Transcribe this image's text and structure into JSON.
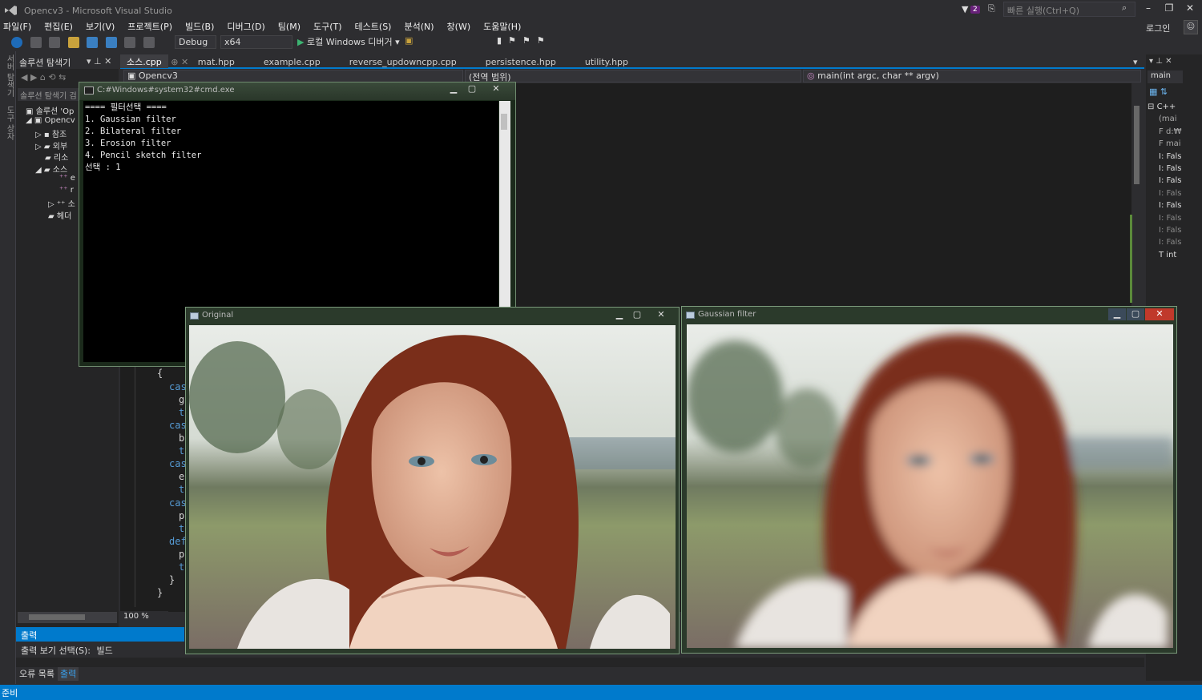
{
  "window": {
    "title": "Opencv3 - Microsoft Visual Studio",
    "notifications": "2",
    "quick_launch_placeholder": "빠른 실행(Ctrl+Q)",
    "login": "로그인"
  },
  "menu": [
    "파일(F)",
    "편집(E)",
    "보기(V)",
    "프로젝트(P)",
    "빌드(B)",
    "디버그(D)",
    "팀(M)",
    "도구(T)",
    "테스트(S)",
    "분석(N)",
    "창(W)",
    "도움말(H)"
  ],
  "toolbar": {
    "config": "Debug",
    "platform": "x64",
    "run_label": "로컬 Windows 디버거"
  },
  "left_strip": {
    "item1": "서버 탐색기",
    "item2": "도구 상자"
  },
  "solution_explorer": {
    "title": "솔루션 탐색기",
    "search_placeholder": "솔루션 탐색기 검",
    "items": [
      "솔루션 'Op",
      "Opencv",
      "참조",
      "외부",
      "리소",
      "소스",
      "e",
      "r",
      "소",
      "헤더"
    ]
  },
  "tabs": [
    "소스.cpp",
    "mat.hpp",
    "example.cpp",
    "reverse_updowncpp.cpp",
    "persistence.hpp",
    "utility.hpp"
  ],
  "navbar": {
    "project": "Opencv3",
    "scope": "(전역 범위)",
    "function": "main(int argc, char ** argv)"
  },
  "code_fragments": [
    "{",
    "cas",
    "g",
    "t",
    "cas",
    "b",
    "t",
    "cas",
    "e",
    "t",
    "cas",
    "p",
    "t",
    "def",
    "p",
    "t",
    "}",
    "}"
  ],
  "zoom": "100 %",
  "cmd": {
    "title": "C:#Windows#system32#cmd.exe",
    "lines": [
      "==== 필터선택 ====",
      "1. Gaussian filter",
      "2. Bilateral filter",
      "3. Erosion filter",
      "4. Pencil sketch filter",
      "선택 : 1"
    ]
  },
  "original_window": {
    "title": "Original"
  },
  "gaussian_window": {
    "title": "Gaussian filter"
  },
  "right_panel": {
    "title": "main",
    "items": [
      "C++",
      "(mai",
      "d:₩",
      "mai",
      "Fals",
      "Fals",
      "Fals",
      "Fals",
      "Fals",
      "Fals",
      "Fals",
      "Fals",
      "int"
    ]
  },
  "output": {
    "header": "출력",
    "show_label": "출력 보기 선택(S):",
    "show_value": "빌드"
  },
  "bottom_tabs": [
    "오류 목록",
    "출력"
  ],
  "status": "준비"
}
